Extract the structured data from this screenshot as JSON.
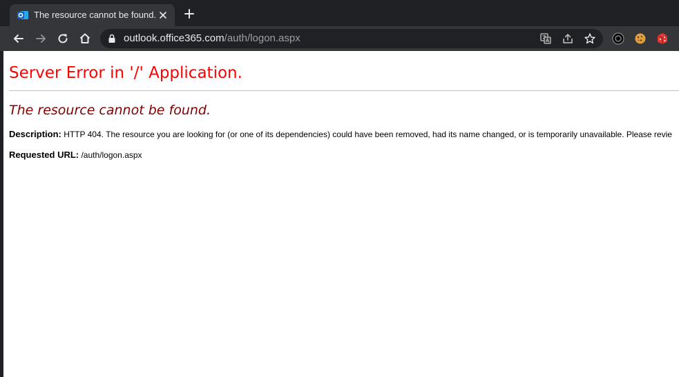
{
  "browser": {
    "tab": {
      "title": "The resource cannot be found.",
      "favicon": "outlook-icon"
    },
    "address_bar": {
      "host": "outlook.office365.com",
      "path": "/auth/logon.aspx"
    },
    "toolbar_icons": [
      "back-icon",
      "forward-icon",
      "reload-icon",
      "home-icon",
      "lock-icon",
      "translate-icon",
      "share-icon",
      "bookmark-star-icon"
    ],
    "extensions": [
      "dark-circle-extension-icon",
      "cookie-extension-icon",
      "red-cube-extension-icon"
    ]
  },
  "page": {
    "heading": "Server Error in '/' Application.",
    "subheading": "The resource cannot be found.",
    "description_label": "Description:",
    "description_text": "HTTP 404. The resource you are looking for (or one of its dependencies) could have been removed, had its name changed, or is temporarily unavailable.  Please revie",
    "requested_url_label": "Requested URL:",
    "requested_url_value": "/auth/logon.aspx"
  },
  "colors": {
    "heading": "#ff0000",
    "subheading": "#800000",
    "chrome_dark": "#202124",
    "chrome_toolbar": "#35363a",
    "outlook_blue": "#0a64c8"
  }
}
